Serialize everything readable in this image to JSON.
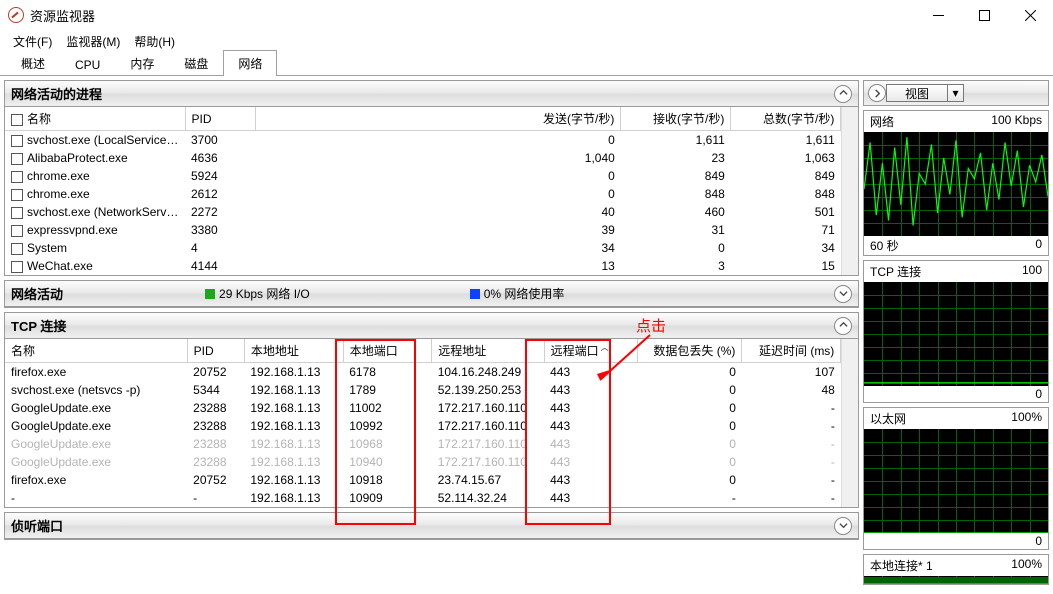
{
  "window": {
    "title": "资源监视器"
  },
  "menu": {
    "file": "文件(F)",
    "monitor": "监视器(M)",
    "help": "帮助(H)"
  },
  "tabs": {
    "overview": "概述",
    "cpu": "CPU",
    "memory": "内存",
    "disk": "磁盘",
    "network": "网络"
  },
  "procPanel": {
    "title": "网络活动的进程",
    "cols": {
      "name": "名称",
      "pid": "PID",
      "send": "发送(字节/秒)",
      "recv": "接收(字节/秒)",
      "total": "总数(字节/秒)"
    },
    "rows": [
      {
        "name": "svchost.exe (LocalServiceA...",
        "pid": "3700",
        "send": "0",
        "recv": "1,611",
        "total": "1,611"
      },
      {
        "name": "AlibabaProtect.exe",
        "pid": "4636",
        "send": "1,040",
        "recv": "23",
        "total": "1,063"
      },
      {
        "name": "chrome.exe",
        "pid": "5924",
        "send": "0",
        "recv": "849",
        "total": "849"
      },
      {
        "name": "chrome.exe",
        "pid": "2612",
        "send": "0",
        "recv": "848",
        "total": "848"
      },
      {
        "name": "svchost.exe (NetworkServic...",
        "pid": "2272",
        "send": "40",
        "recv": "460",
        "total": "501"
      },
      {
        "name": "expressvpnd.exe",
        "pid": "3380",
        "send": "39",
        "recv": "31",
        "total": "71"
      },
      {
        "name": "System",
        "pid": "4",
        "send": "34",
        "recv": "0",
        "total": "34"
      },
      {
        "name": "WeChat.exe",
        "pid": "4144",
        "send": "13",
        "recv": "3",
        "total": "15"
      }
    ]
  },
  "activityBar": {
    "title": "网络活动",
    "io": "29 Kbps 网络 I/O",
    "usage": "0% 网络使用率"
  },
  "connPanel": {
    "title": "TCP 连接",
    "cols": {
      "name": "名称",
      "pid": "PID",
      "laddr": "本地地址",
      "lport": "本地端口",
      "raddr": "远程地址",
      "rport": "远程端口",
      "loss": "数据包丢失 (%)",
      "latency": "延迟时间 (ms)"
    },
    "rows": [
      {
        "name": "firefox.exe",
        "pid": "20752",
        "laddr": "192.168.1.13",
        "lport": "6178",
        "raddr": "104.16.248.249",
        "rport": "443",
        "loss": "0",
        "lat": "107",
        "dim": false
      },
      {
        "name": "svchost.exe (netsvcs -p)",
        "pid": "5344",
        "laddr": "192.168.1.13",
        "lport": "1789",
        "raddr": "52.139.250.253",
        "rport": "443",
        "loss": "0",
        "lat": "48",
        "dim": false
      },
      {
        "name": "GoogleUpdate.exe",
        "pid": "23288",
        "laddr": "192.168.1.13",
        "lport": "11002",
        "raddr": "172.217.160.110",
        "rport": "443",
        "loss": "0",
        "lat": "-",
        "dim": false
      },
      {
        "name": "GoogleUpdate.exe",
        "pid": "23288",
        "laddr": "192.168.1.13",
        "lport": "10992",
        "raddr": "172.217.160.110",
        "rport": "443",
        "loss": "0",
        "lat": "-",
        "dim": false
      },
      {
        "name": "GoogleUpdate.exe",
        "pid": "23288",
        "laddr": "192.168.1.13",
        "lport": "10968",
        "raddr": "172.217.160.110",
        "rport": "443",
        "loss": "0",
        "lat": "-",
        "dim": true
      },
      {
        "name": "GoogleUpdate.exe",
        "pid": "23288",
        "laddr": "192.168.1.13",
        "lport": "10940",
        "raddr": "172.217.160.110",
        "rport": "443",
        "loss": "0",
        "lat": "-",
        "dim": true
      },
      {
        "name": "firefox.exe",
        "pid": "20752",
        "laddr": "192.168.1.13",
        "lport": "10918",
        "raddr": "23.74.15.67",
        "rport": "443",
        "loss": "0",
        "lat": "-",
        "dim": false
      },
      {
        "name": "-",
        "pid": "-",
        "laddr": "192.168.1.13",
        "lport": "10909",
        "raddr": "52.114.32.24",
        "rport": "443",
        "loss": "-",
        "lat": "-",
        "dim": false
      }
    ]
  },
  "listenPanel": {
    "title": "侦听端口"
  },
  "rightTop": {
    "view": "视图"
  },
  "charts": {
    "net": {
      "title": "网络",
      "right": "100 Kbps",
      "footL": "60 秒",
      "footR": "0"
    },
    "tcp": {
      "title": "TCP 连接",
      "right": "100",
      "footR": "0"
    },
    "eth": {
      "title": "以太网",
      "right": "100%",
      "footR": "0"
    },
    "local": {
      "title": "本地连接* 1",
      "right": "100%"
    }
  },
  "annot": {
    "click": "点击"
  },
  "chart_data": [
    {
      "type": "line",
      "title": "网络",
      "ylabel": "Kbps",
      "ylim": [
        0,
        100
      ],
      "xlim_seconds": [
        60,
        0
      ],
      "series": [
        {
          "name": "net-io",
          "values": [
            45,
            90,
            20,
            70,
            15,
            85,
            30,
            95,
            10,
            60,
            50,
            88,
            22,
            75,
            40,
            92,
            18,
            65,
            55,
            80,
            25,
            70,
            35,
            90,
            48,
            82,
            28,
            68,
            52,
            78,
            38
          ]
        }
      ]
    },
    {
      "type": "line",
      "title": "TCP 连接",
      "ylim": [
        0,
        100
      ],
      "series": [
        {
          "name": "tcp",
          "values": [
            3,
            3,
            3,
            3,
            3,
            3,
            3,
            3,
            3,
            3,
            3,
            3,
            3,
            3,
            3,
            3,
            3,
            3,
            3,
            3,
            3,
            3,
            3,
            3,
            3,
            3,
            3,
            3,
            3,
            3,
            3
          ]
        }
      ]
    },
    {
      "type": "line",
      "title": "以太网",
      "ylabel": "%",
      "ylim": [
        0,
        100
      ],
      "series": [
        {
          "name": "eth",
          "values": [
            0,
            0,
            0,
            0,
            0,
            0,
            0,
            0,
            0,
            0,
            0,
            0,
            0,
            0,
            0,
            0,
            0,
            0,
            0,
            0,
            0,
            0,
            0,
            0,
            0,
            0,
            0,
            0,
            0,
            0,
            0
          ]
        }
      ]
    },
    {
      "type": "line",
      "title": "本地连接* 1",
      "ylabel": "%",
      "ylim": [
        0,
        100
      ],
      "series": [
        {
          "name": "local",
          "values": [
            0,
            0,
            0,
            0,
            0,
            0,
            0,
            0,
            0,
            0,
            0,
            0,
            0,
            0,
            0,
            0,
            0,
            0,
            0,
            0,
            0,
            0,
            0,
            0,
            0,
            0,
            0,
            0,
            0,
            0,
            0
          ]
        }
      ]
    }
  ]
}
